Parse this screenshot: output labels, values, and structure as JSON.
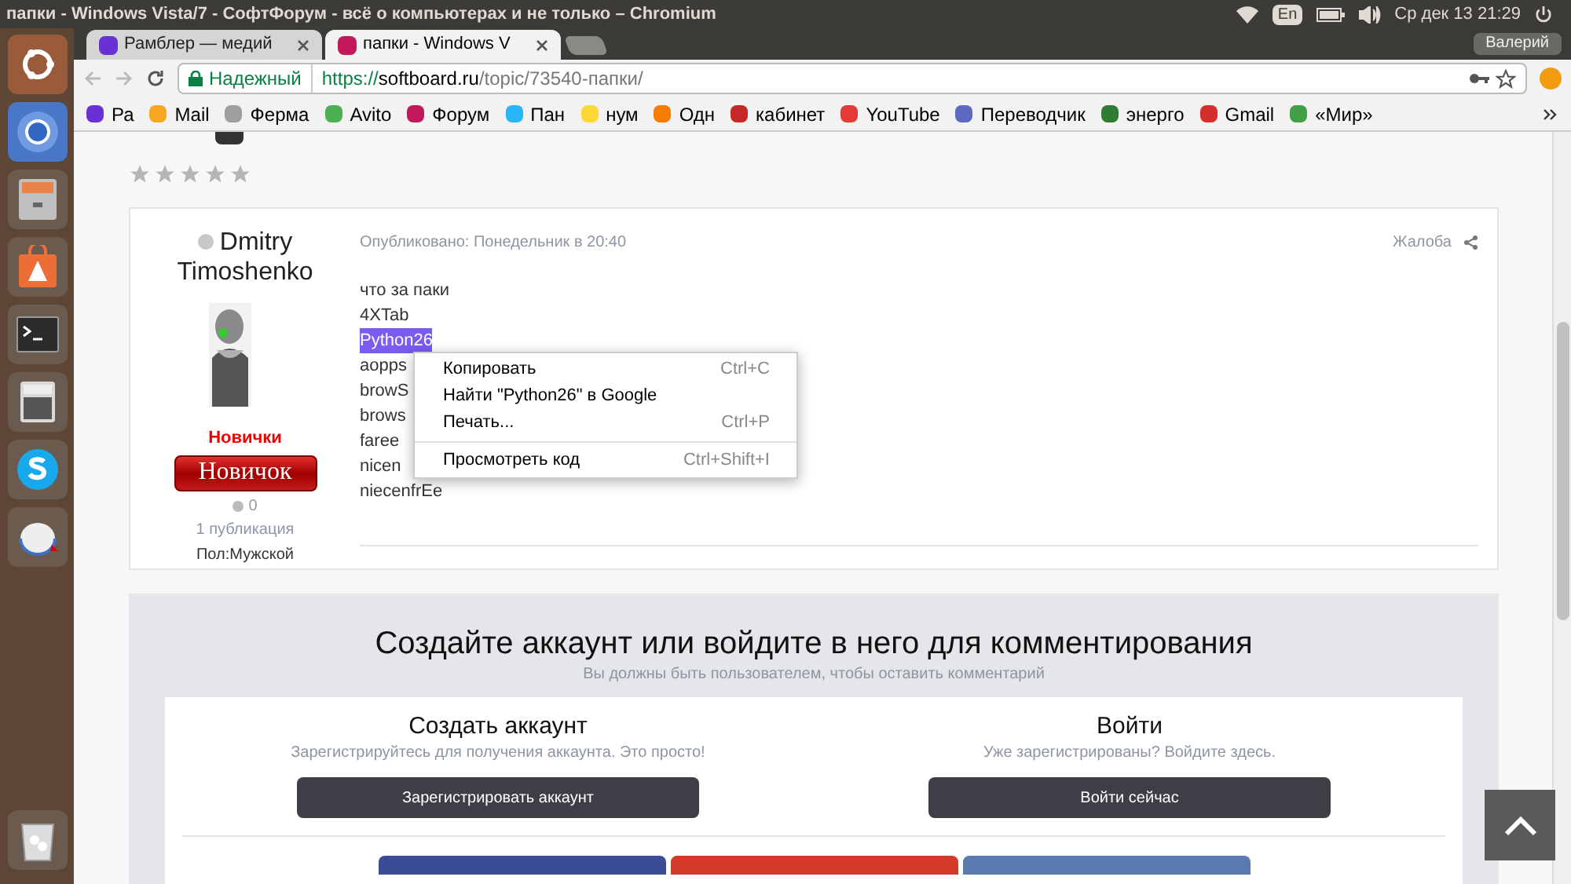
{
  "top_panel": {
    "title": "папки - Windows Vista/7 - СофтФорум - всё о компьютерах и не только – Chromium",
    "keyboard": "En",
    "clock": "Ср дек 13 21:29"
  },
  "tabs": [
    {
      "title": "Рамблер — медий",
      "selected": false,
      "color": "#6b2fd6"
    },
    {
      "title": "папки - Windows V",
      "selected": true,
      "color": "#c2185b"
    }
  ],
  "profile": "Валерий",
  "address": {
    "secure_label": "Надежный",
    "scheme": "https://",
    "host": "softboard.ru",
    "path": "/topic/73540-папки/"
  },
  "bookmarks": [
    {
      "label": "Ра",
      "color": "#6b2fd6"
    },
    {
      "label": "Mail",
      "color": "#f5a623"
    },
    {
      "label": "Ферма",
      "color": "#9e9e9e"
    },
    {
      "label": "Avito",
      "color": "#4caf50"
    },
    {
      "label": "Форум",
      "color": "#c2185b"
    },
    {
      "label": "Пан",
      "color": "#29b6f6"
    },
    {
      "label": "нум",
      "color": "#fdd835"
    },
    {
      "label": "Одн",
      "color": "#f57c00"
    },
    {
      "label": "кабинет",
      "color": "#c62828"
    },
    {
      "label": "YouTube",
      "color": "#e53935"
    },
    {
      "label": "Переводчик",
      "color": "#5c6bc0"
    },
    {
      "label": "энерго",
      "color": "#2e7d32"
    },
    {
      "label": "Gmail",
      "color": "#d32f2f"
    },
    {
      "label": "«Мир»",
      "color": "#43a047"
    }
  ],
  "post": {
    "stars": 0,
    "author": "Dmitry Timoshenko",
    "online": false,
    "group": "Новички",
    "rank": "Новичок",
    "reputation": "0",
    "posts": "1 публикация",
    "gender": "Пол:Мужской",
    "published": "Опубликовано: Понедельник в 20:40",
    "report": "Жалоба",
    "lines": [
      {
        "text": "что за паки",
        "selected": false
      },
      {
        "text": "4XTab",
        "selected": false
      },
      {
        "text": "Python26",
        "selected": true
      },
      {
        "text": "aopps",
        "selected": false
      },
      {
        "text": "browS",
        "selected": false
      },
      {
        "text": "brows",
        "selected": false
      },
      {
        "text": "faree",
        "selected": false
      },
      {
        "text": "nicen",
        "selected": false
      },
      {
        "text": "niecenfrEe",
        "selected": false
      }
    ]
  },
  "context_menu": [
    {
      "label": "Копировать",
      "shortcut": "Ctrl+C",
      "separator_before": false
    },
    {
      "label": "Найти \"Python26\" в Google",
      "separator_before": false
    },
    {
      "label": "Печать...",
      "shortcut": "Ctrl+P",
      "separator_before": false
    },
    {
      "label": "Просмотреть код",
      "shortcut": "Ctrl+Shift+I",
      "separator_before": true
    }
  ],
  "signin": {
    "title": "Создайте аккаунт или войдите в него для комментирования",
    "subtitle": "Вы должны быть пользователем, чтобы оставить комментарий",
    "columns": [
      {
        "title": "Создать аккаунт",
        "subtitle": "Зарегистрируйтесь для получения аккаунта. Это просто!",
        "button": "Зарегистрировать аккаунт"
      },
      {
        "title": "Войти",
        "subtitle": "Уже зарегистрированы? Войдите здесь.",
        "button": "Войти сейчас"
      }
    ],
    "social": [
      {
        "color": "#3b4b98"
      },
      {
        "color": "#d23a2a"
      },
      {
        "color": "#5a7bb0"
      }
    ]
  }
}
